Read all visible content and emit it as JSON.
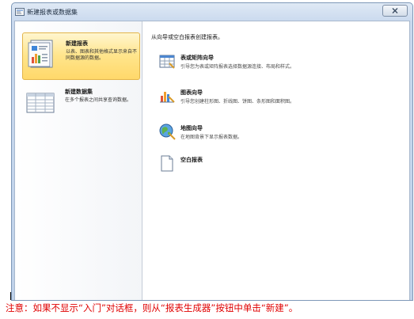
{
  "window": {
    "title": "新建报表或数据集"
  },
  "sidebar": {
    "items": [
      {
        "title": "新建报表",
        "description": "以表、图表和其他格式显示来自不同数据源的数据。",
        "selected": true
      },
      {
        "title": "新建数据集",
        "description": "在多个报表之间共享查询数据。",
        "selected": false
      }
    ]
  },
  "main": {
    "header": "从向导或空白报表创建报表。",
    "options": [
      {
        "title": "表或矩阵向导",
        "description": "引导您为表或矩阵报表选择数据源连接、布局和样式。",
        "icon": "table-wizard-icon"
      },
      {
        "title": "图表向导",
        "description": "引导您创建柱形图、折线图、饼图、条形图和面积图。",
        "icon": "chart-wizard-icon"
      },
      {
        "title": "地图向导",
        "description": "在地图背景下显示报表数据。",
        "icon": "map-wizard-icon"
      },
      {
        "title": "空白报表",
        "description": "",
        "icon": "blank-report-icon"
      }
    ]
  },
  "note": "注意：如果不显示“入门”对话框，则从“报表生成器”按钮中单击“新建”。",
  "colors": {
    "selected_bg": "#ffe58c",
    "selected_border": "#e3b54a",
    "note_text": "#e00000",
    "title_bar": "#c9d9ee"
  }
}
